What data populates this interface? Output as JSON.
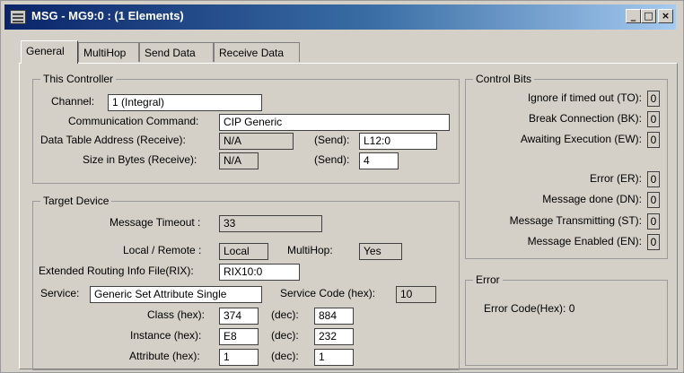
{
  "window": {
    "title": "MSG - MG9:0 : (1 Elements)",
    "minimize": "_",
    "maximize": "□",
    "close": "×"
  },
  "tabs": [
    "General",
    "MultiHop",
    "Send Data",
    "Receive Data"
  ],
  "controller": {
    "legend": "This Controller",
    "channel_label": "Channel:",
    "channel": "1 (Integral)",
    "command_label": "Communication Command:",
    "command": "CIP Generic",
    "dta_label": "Data Table Address (Receive):",
    "dta_receive": "N/A",
    "send_label": "(Send):",
    "dta_send": "L12:0",
    "size_label": "Size in Bytes (Receive):",
    "size_receive": "N/A",
    "size_send": "4"
  },
  "target": {
    "legend": "Target Device",
    "timeout_label": "Message Timeout :",
    "timeout": "33",
    "local_label": "Local / Remote :",
    "local": "Local",
    "multihop_label": "MultiHop:",
    "multihop": "Yes",
    "rix_label": "Extended Routing Info File(RIX):",
    "rix": "RIX10:0",
    "service_label": "Service:",
    "service": "Generic Set Attribute Single",
    "service_code_label": "Service Code (hex):",
    "service_code": "10",
    "class_label": "Class (hex):",
    "class_hex": "374",
    "dec_label": "(dec):",
    "class_dec": "884",
    "instance_label": "Instance (hex):",
    "instance_hex": "E8",
    "instance_dec": "232",
    "attribute_label": "Attribute (hex):",
    "attribute_hex": "1",
    "attribute_dec": "1"
  },
  "control_bits": {
    "legend": "Control Bits",
    "items": [
      {
        "label": "Ignore if timed out (TO):",
        "value": "0"
      },
      {
        "label": "Break Connection (BK):",
        "value": "0"
      },
      {
        "label": "Awaiting Execution (EW):",
        "value": "0"
      },
      {
        "label": "Error (ER):",
        "value": "0"
      },
      {
        "label": "Message done (DN):",
        "value": "0"
      },
      {
        "label": "Message Transmitting (ST):",
        "value": "0"
      },
      {
        "label": "Message Enabled (EN):",
        "value": "0"
      }
    ]
  },
  "error": {
    "legend": "Error",
    "code_text": "Error Code(Hex): 0"
  }
}
